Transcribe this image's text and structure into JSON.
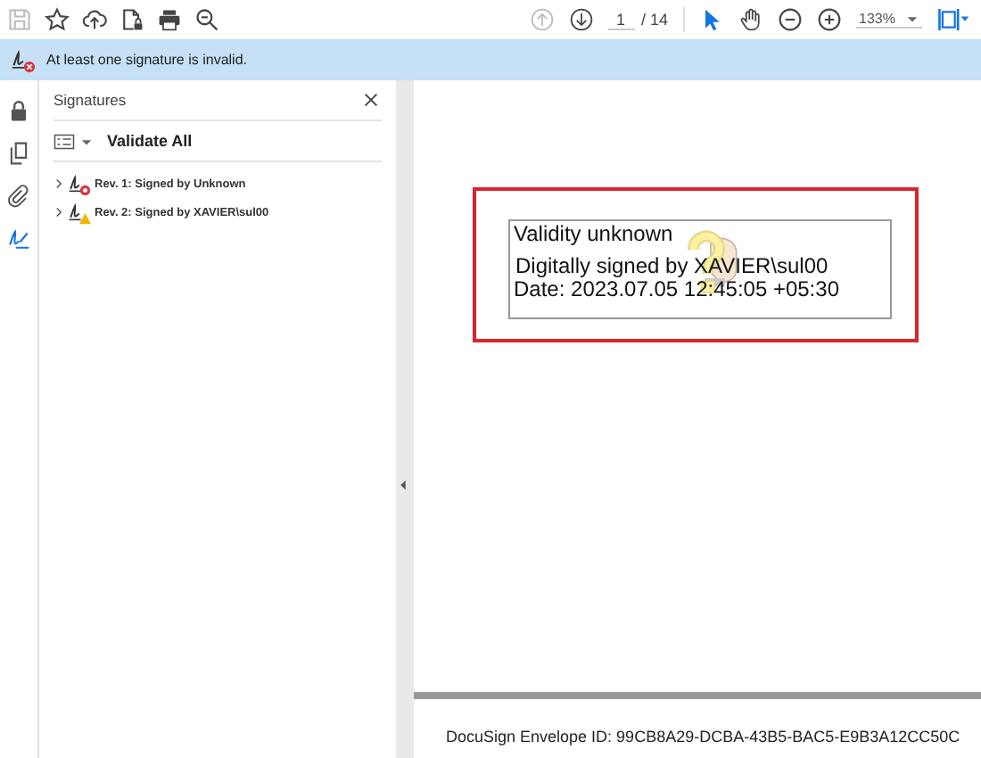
{
  "toolbar": {
    "page": "1",
    "page_total": "/ 14",
    "zoom": "133%",
    "tools": [
      {
        "kind": "select",
        "selected": true
      },
      {
        "kind": "hand",
        "selected": false
      }
    ]
  },
  "banner": {
    "message": "At least one signature is invalid."
  },
  "sidebar": {
    "title": "Signatures",
    "validate_all": "Validate All",
    "items": [
      {
        "label": "Rev. 1: Signed by Unknown",
        "kind": "invalid",
        "expanded": false
      },
      {
        "label": "Rev. 2: Signed by XAVIER\\sul00",
        "kind": "warning",
        "expanded": false
      }
    ]
  },
  "document": {
    "signature": {
      "status": "Validity unknown",
      "signed_by": "Digitally signed by XAVIER\\sul00",
      "date": "Date: 2023.07.05 12:45:05 +05:30"
    },
    "footer": "DocuSign Envelope ID: 99CB8A29-DCBA-43B5-BAC5-E9B3A12CC50C"
  }
}
